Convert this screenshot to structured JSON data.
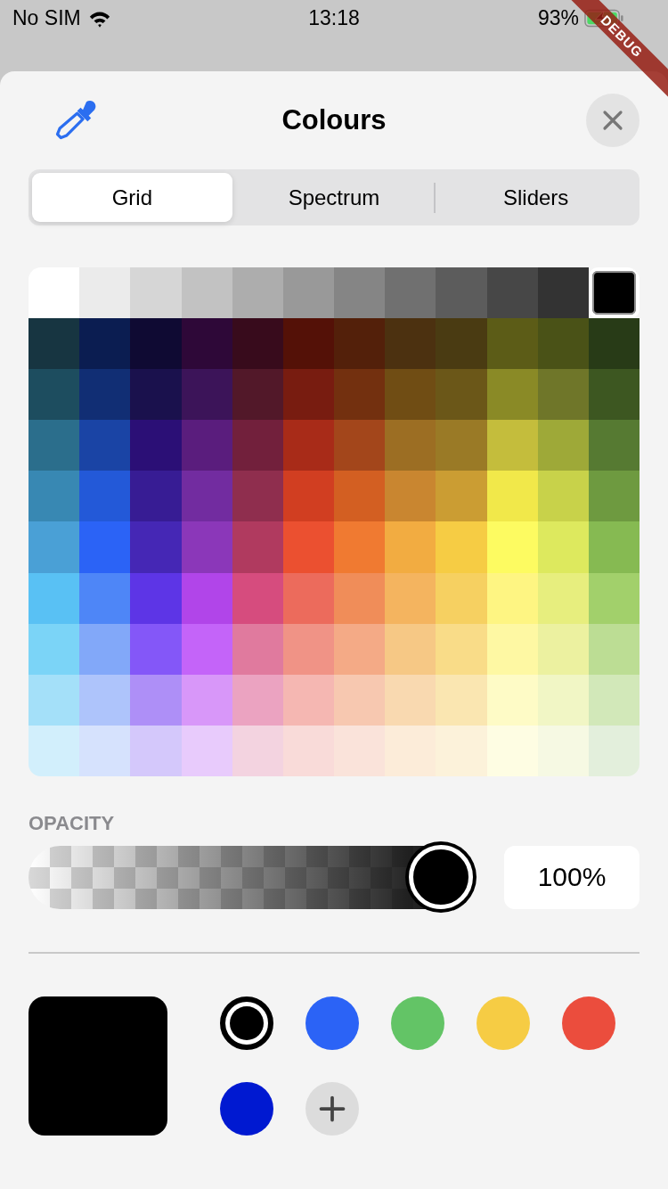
{
  "status_bar": {
    "carrier": "No SIM",
    "time": "13:18",
    "battery": "93%"
  },
  "debug_banner": "DEBUG",
  "title": "Colours",
  "tabs": [
    {
      "label": "Grid",
      "selected": true
    },
    {
      "label": "Spectrum",
      "selected": false
    },
    {
      "label": "Sliders",
      "selected": false
    }
  ],
  "grid": [
    [
      {
        "color": "#ffffff",
        "selected": false
      },
      {
        "color": "#ebebeb",
        "selected": false
      },
      {
        "color": "#d6d6d6",
        "selected": false
      },
      {
        "color": "#c2c2c2",
        "selected": false
      },
      {
        "color": "#adadad",
        "selected": false
      },
      {
        "color": "#999999",
        "selected": false
      },
      {
        "color": "#858585",
        "selected": false
      },
      {
        "color": "#707070",
        "selected": false
      },
      {
        "color": "#5c5c5c",
        "selected": false
      },
      {
        "color": "#474747",
        "selected": false
      },
      {
        "color": "#333333",
        "selected": false
      },
      {
        "color": "#000000",
        "selected": true
      }
    ],
    [
      {
        "color": "#173541",
        "selected": false
      },
      {
        "color": "#0b1d51",
        "selected": false
      },
      {
        "color": "#0f0a33",
        "selected": false
      },
      {
        "color": "#2e0838",
        "selected": false
      },
      {
        "color": "#380b1c",
        "selected": false
      },
      {
        "color": "#541107",
        "selected": false
      },
      {
        "color": "#53200a",
        "selected": false
      },
      {
        "color": "#4c3110",
        "selected": false
      },
      {
        "color": "#4a3b12",
        "selected": false
      },
      {
        "color": "#5c5c17",
        "selected": false
      },
      {
        "color": "#4a5217",
        "selected": false
      },
      {
        "color": "#283b17",
        "selected": false
      }
    ],
    [
      {
        "color": "#1d4d5f",
        "selected": false
      },
      {
        "color": "#112e74",
        "selected": false
      },
      {
        "color": "#1a114d",
        "selected": false
      },
      {
        "color": "#3c1459",
        "selected": false
      },
      {
        "color": "#521829",
        "selected": false
      },
      {
        "color": "#781c10",
        "selected": false
      },
      {
        "color": "#73300f",
        "selected": false
      },
      {
        "color": "#704d14",
        "selected": false
      },
      {
        "color": "#6b5718",
        "selected": false
      },
      {
        "color": "#8a8a26",
        "selected": false
      },
      {
        "color": "#6f7629",
        "selected": false
      },
      {
        "color": "#3d5721",
        "selected": false
      }
    ],
    [
      {
        "color": "#2b6e8c",
        "selected": false
      },
      {
        "color": "#1a44a5",
        "selected": false
      },
      {
        "color": "#2b0f76",
        "selected": false
      },
      {
        "color": "#5a1d7d",
        "selected": false
      },
      {
        "color": "#72203c",
        "selected": false
      },
      {
        "color": "#a82b18",
        "selected": false
      },
      {
        "color": "#a3461b",
        "selected": false
      },
      {
        "color": "#9c6e23",
        "selected": false
      },
      {
        "color": "#9a7a26",
        "selected": false
      },
      {
        "color": "#c4bd3c",
        "selected": false
      },
      {
        "color": "#9ea938",
        "selected": false
      },
      {
        "color": "#567a32",
        "selected": false
      }
    ],
    [
      {
        "color": "#3888b3",
        "selected": false
      },
      {
        "color": "#2359d8",
        "selected": false
      },
      {
        "color": "#371c94",
        "selected": false
      },
      {
        "color": "#722ca0",
        "selected": false
      },
      {
        "color": "#8f2e4e",
        "selected": false
      },
      {
        "color": "#d13e21",
        "selected": false
      },
      {
        "color": "#d35f22",
        "selected": false
      },
      {
        "color": "#c98630",
        "selected": false
      },
      {
        "color": "#cb9d33",
        "selected": false
      },
      {
        "color": "#f1e84a",
        "selected": false
      },
      {
        "color": "#c8d24a",
        "selected": false
      },
      {
        "color": "#6e9a40",
        "selected": false
      }
    ],
    [
      {
        "color": "#4aa0d6",
        "selected": false
      },
      {
        "color": "#2b63f6",
        "selected": false
      },
      {
        "color": "#4527b5",
        "selected": false
      },
      {
        "color": "#8b37b9",
        "selected": false
      },
      {
        "color": "#b03a5f",
        "selected": false
      },
      {
        "color": "#eb5030",
        "selected": false
      },
      {
        "color": "#f07a31",
        "selected": false
      },
      {
        "color": "#f2ac41",
        "selected": false
      },
      {
        "color": "#f6cc44",
        "selected": false
      },
      {
        "color": "#fdfb61",
        "selected": false
      },
      {
        "color": "#dde95e",
        "selected": false
      },
      {
        "color": "#86ba52",
        "selected": false
      }
    ],
    [
      {
        "color": "#59c1f4",
        "selected": false
      },
      {
        "color": "#4e86f7",
        "selected": false
      },
      {
        "color": "#5d35e6",
        "selected": false
      },
      {
        "color": "#b145e9",
        "selected": false
      },
      {
        "color": "#d64c7e",
        "selected": false
      },
      {
        "color": "#ec6b5c",
        "selected": false
      },
      {
        "color": "#f08d59",
        "selected": false
      },
      {
        "color": "#f4b45f",
        "selected": false
      },
      {
        "color": "#f6d061",
        "selected": false
      },
      {
        "color": "#fef582",
        "selected": false
      },
      {
        "color": "#e7ee7e",
        "selected": false
      },
      {
        "color": "#a2d06b",
        "selected": false
      }
    ],
    [
      {
        "color": "#7bd4f7",
        "selected": false
      },
      {
        "color": "#82a8f9",
        "selected": false
      },
      {
        "color": "#8457f8",
        "selected": false
      },
      {
        "color": "#c464f9",
        "selected": false
      },
      {
        "color": "#e07a9e",
        "selected": false
      },
      {
        "color": "#f09386",
        "selected": false
      },
      {
        "color": "#f4aa86",
        "selected": false
      },
      {
        "color": "#f6c885",
        "selected": false
      },
      {
        "color": "#f9dc88",
        "selected": false
      },
      {
        "color": "#fef8a3",
        "selected": false
      },
      {
        "color": "#ecf1a0",
        "selected": false
      },
      {
        "color": "#bcdd94",
        "selected": false
      }
    ],
    [
      {
        "color": "#a4e0f9",
        "selected": false
      },
      {
        "color": "#aec4fb",
        "selected": false
      },
      {
        "color": "#ae8ff7",
        "selected": false
      },
      {
        "color": "#d897f9",
        "selected": false
      },
      {
        "color": "#eba3c1",
        "selected": false
      },
      {
        "color": "#f5b7b2",
        "selected": false
      },
      {
        "color": "#f7c8b0",
        "selected": false
      },
      {
        "color": "#f9d9b0",
        "selected": false
      },
      {
        "color": "#fae6b1",
        "selected": false
      },
      {
        "color": "#fefbc6",
        "selected": false
      },
      {
        "color": "#f1f6c5",
        "selected": false
      },
      {
        "color": "#d2e8b9",
        "selected": false
      }
    ],
    [
      {
        "color": "#d2effc",
        "selected": false
      },
      {
        "color": "#d6e2fd",
        "selected": false
      },
      {
        "color": "#d4c8fb",
        "selected": false
      },
      {
        "color": "#e8cbfc",
        "selected": false
      },
      {
        "color": "#f3d3e0",
        "selected": false
      },
      {
        "color": "#f9dbd9",
        "selected": false
      },
      {
        "color": "#fae3da",
        "selected": false
      },
      {
        "color": "#fcecd9",
        "selected": false
      },
      {
        "color": "#fcf2da",
        "selected": false
      },
      {
        "color": "#fefde3",
        "selected": false
      },
      {
        "color": "#f6f9e3",
        "selected": false
      },
      {
        "color": "#e3efdc",
        "selected": false
      }
    ]
  ],
  "opacity": {
    "label": "OPACITY",
    "level": 1,
    "value": "100%"
  },
  "current": {
    "color": "#000000"
  },
  "swatches": [
    {
      "color": "#000000",
      "selected": true
    },
    {
      "color": "#2b63f6",
      "selected": false
    },
    {
      "color": "#63c466",
      "selected": false
    },
    {
      "color": "#f6cc44",
      "selected": false
    },
    {
      "color": "#eb4d3d",
      "selected": false
    },
    {
      "color": "#0019d1",
      "selected": false
    }
  ]
}
